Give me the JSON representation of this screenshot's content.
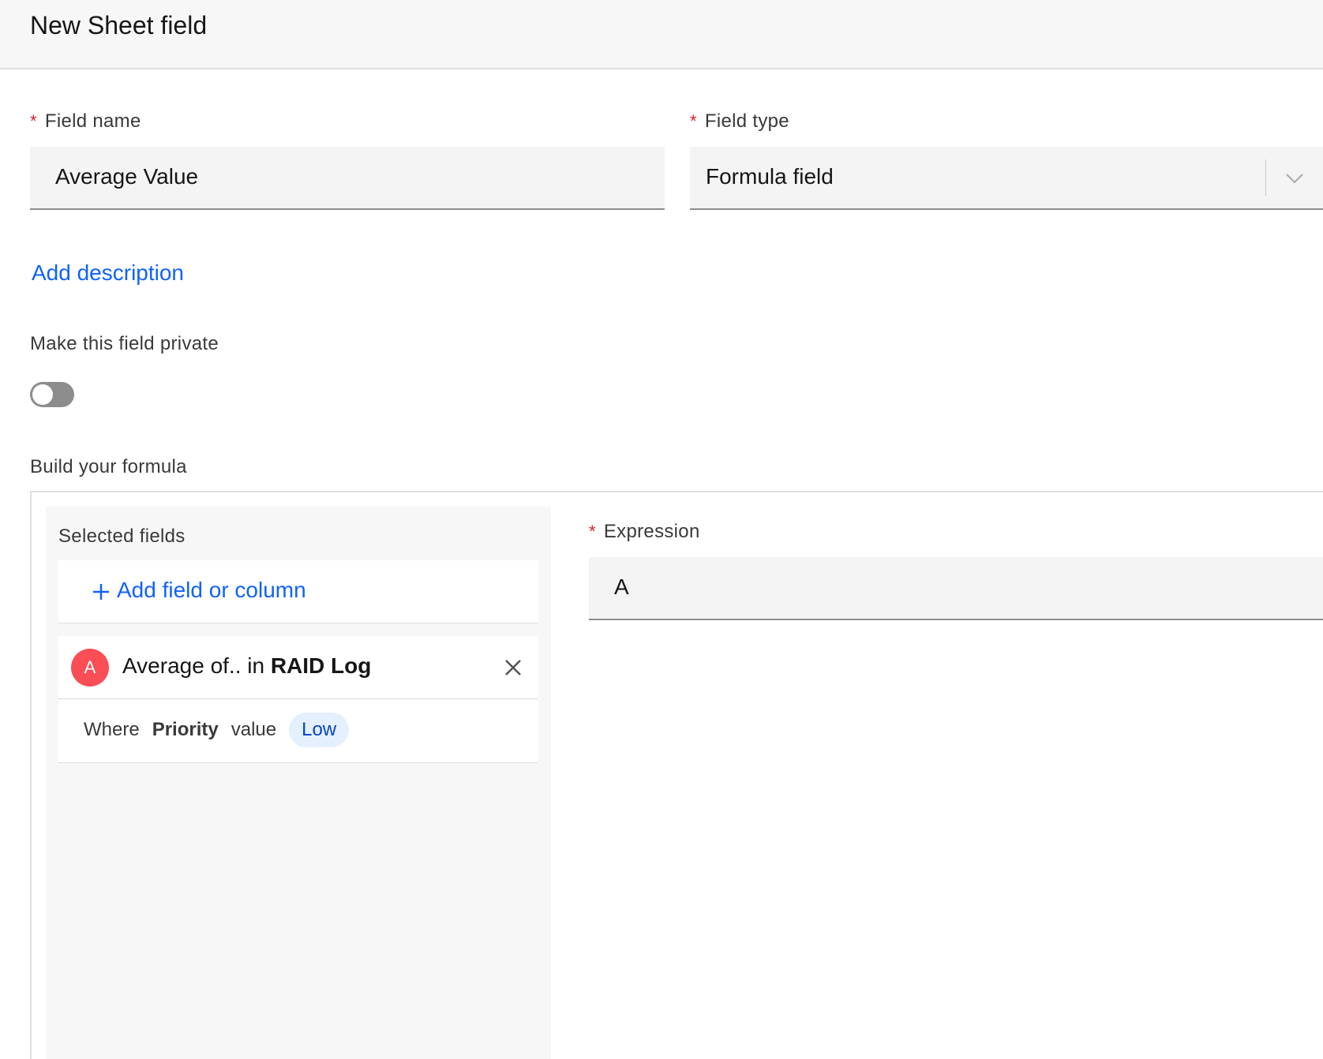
{
  "header": {
    "title": "New Sheet field"
  },
  "form": {
    "required_marker": "*",
    "field_name": {
      "label": "Field name",
      "value": "Average Value"
    },
    "field_type": {
      "label": "Field type",
      "value": "Formula field"
    },
    "add_description_label": "Add description",
    "private": {
      "label": "Make this field private",
      "enabled": false
    }
  },
  "formula": {
    "section_label": "Build your formula",
    "selected_fields_label": "Selected fields",
    "add_field_label": "Add field or column",
    "add_icon": "plus-icon",
    "field_item": {
      "badge": "A",
      "text_prefix": "Average of.. in",
      "sheet_name": "RAID Log",
      "condition_where": "Where",
      "condition_field": "Priority",
      "condition_value_word": "value",
      "condition_value": "Low"
    },
    "expression": {
      "label": "Expression",
      "value": "A"
    }
  },
  "colors": {
    "accent": "#0f62fe",
    "required": "#da1e28",
    "badge": "#fa4d56"
  }
}
